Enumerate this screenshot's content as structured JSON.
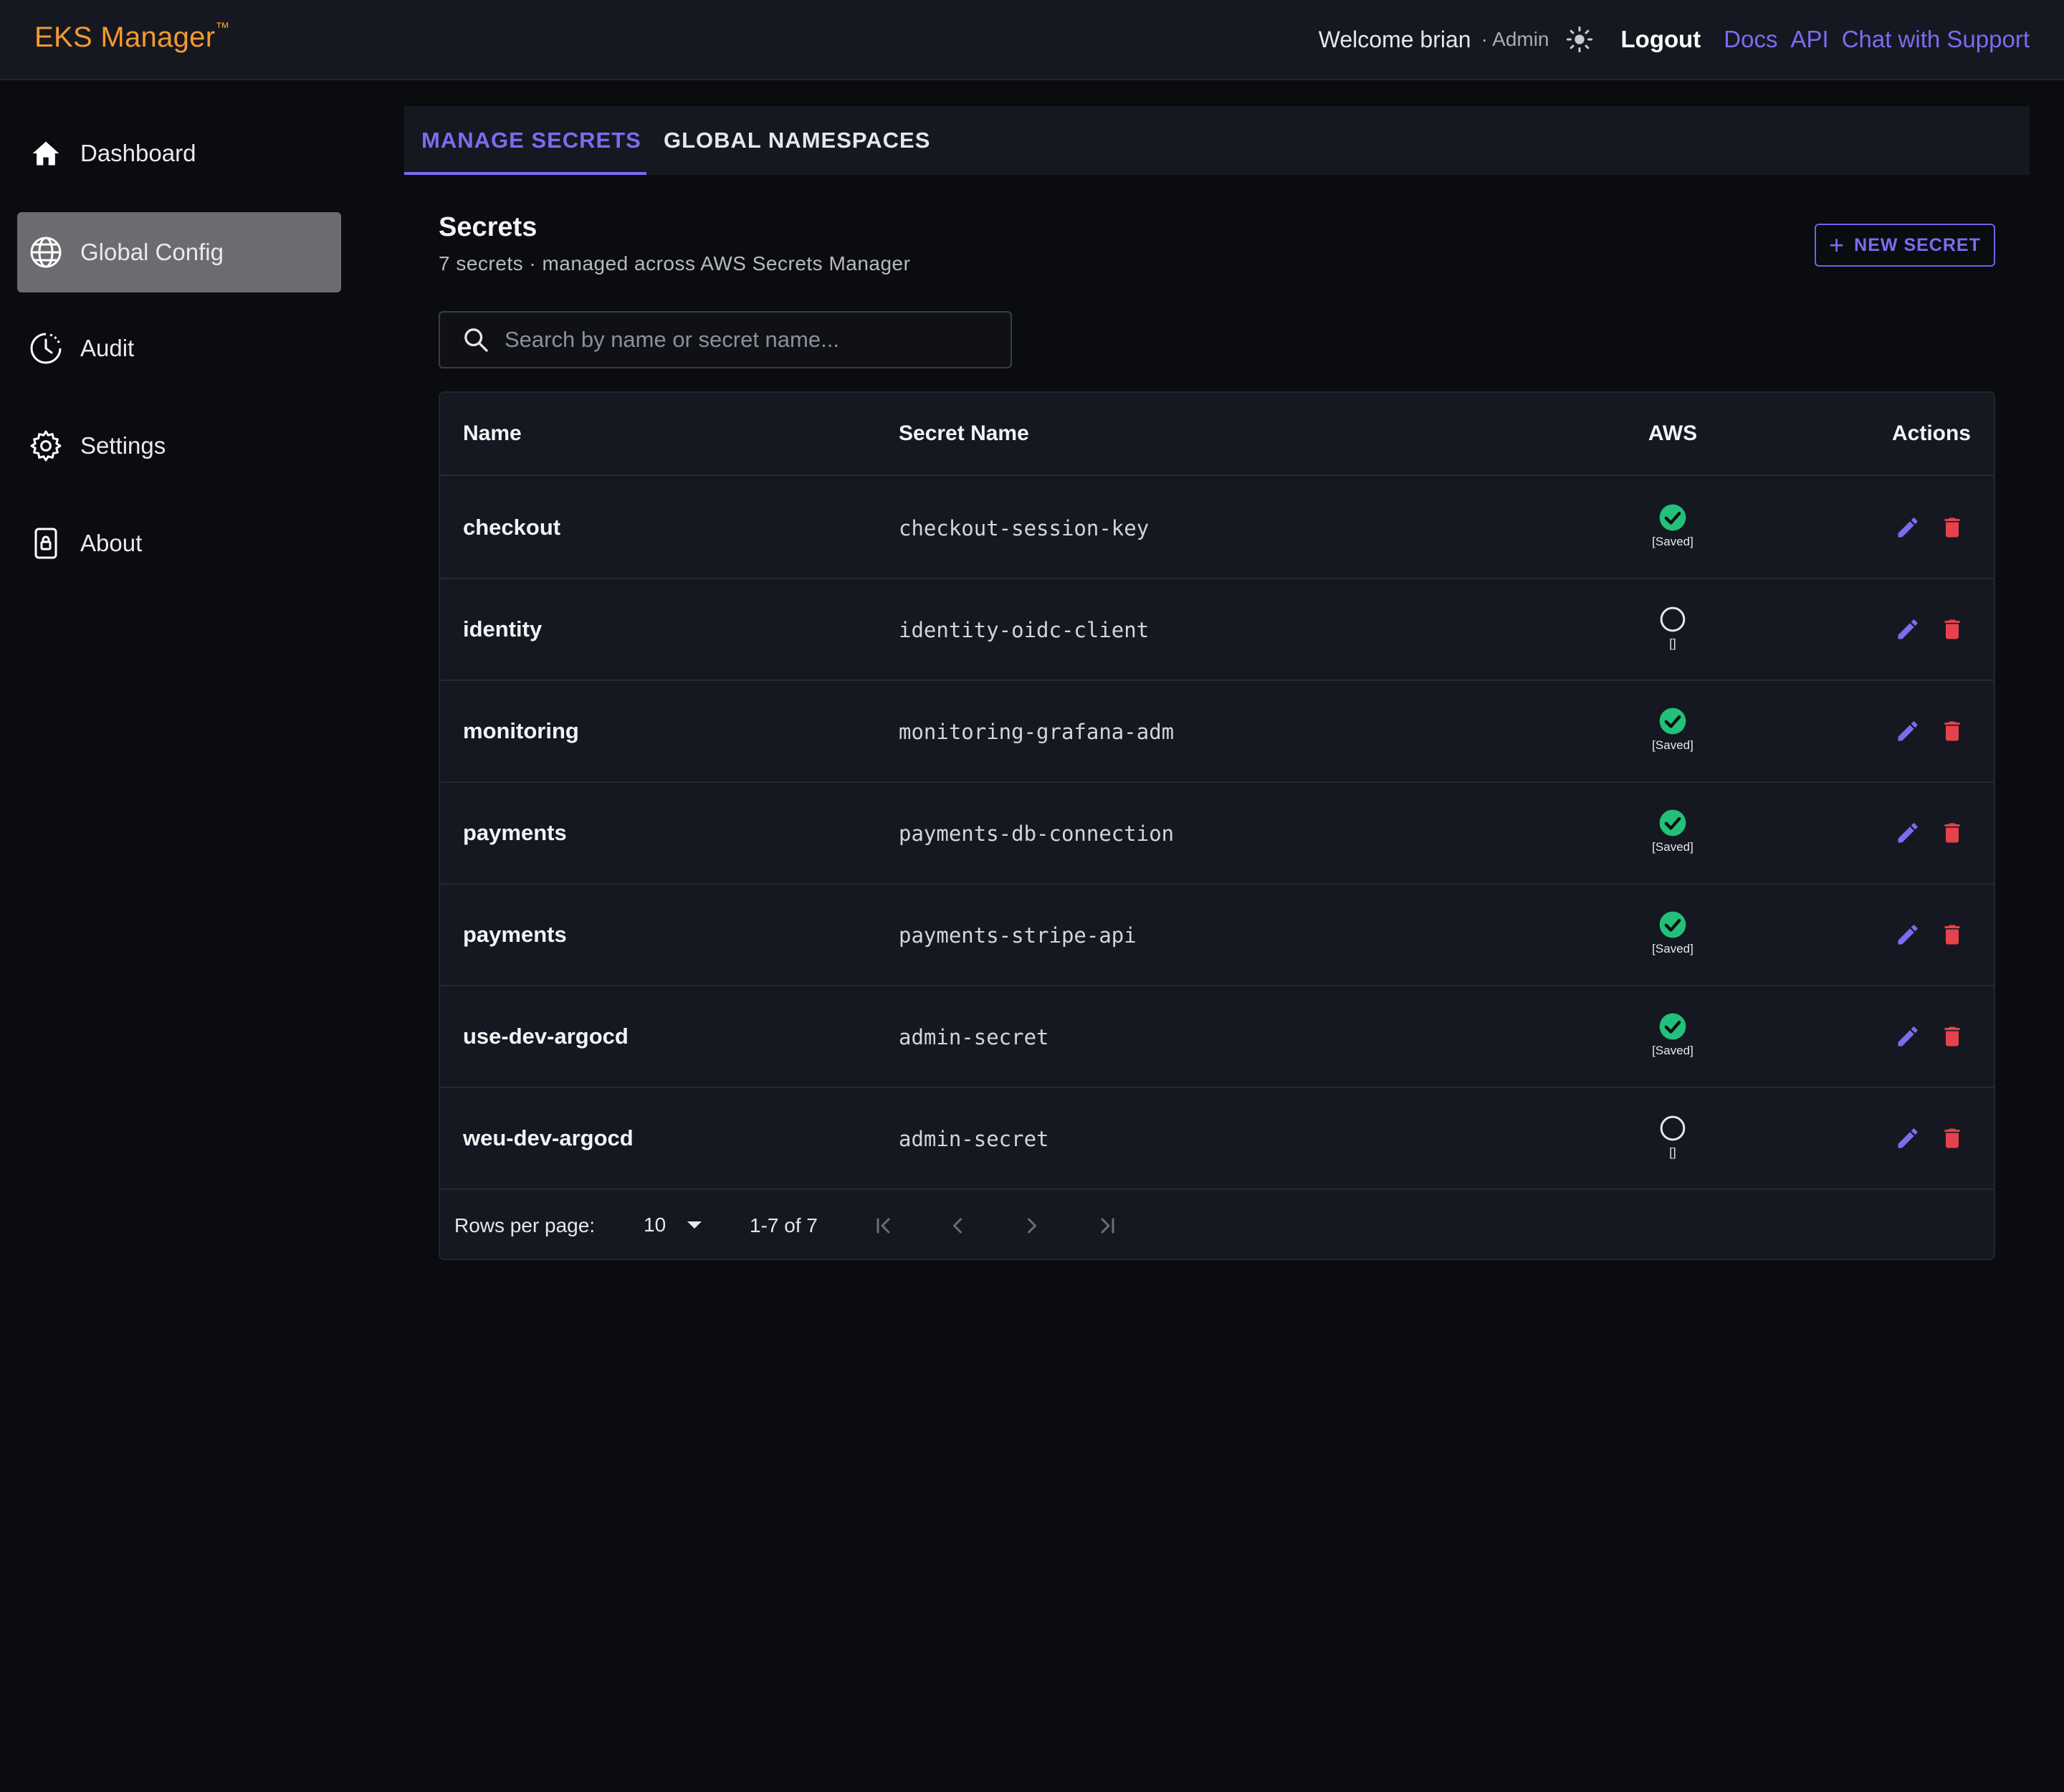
{
  "app": {
    "title": "EKS Manager",
    "trademark": "™"
  },
  "header": {
    "welcome": "Welcome brian",
    "role": "· Admin",
    "theme_icon": "sun-icon",
    "logout": "Logout",
    "links": [
      "Docs",
      "API",
      "Chat with Support"
    ]
  },
  "sidebar": {
    "items": [
      {
        "label": "Dashboard",
        "icon": "home-icon",
        "active": false
      },
      {
        "label": "Global Config",
        "icon": "globe-icon",
        "active": true
      },
      {
        "label": "Audit",
        "icon": "clock-icon",
        "active": false
      },
      {
        "label": "Settings",
        "icon": "gear-icon",
        "active": false
      },
      {
        "label": "About",
        "icon": "lock-icon",
        "active": false
      }
    ]
  },
  "tabs": [
    {
      "label": "MANAGE SECRETS",
      "active": true
    },
    {
      "label": "GLOBAL NAMESPACES",
      "active": false
    }
  ],
  "page": {
    "title": "Secrets",
    "subtitle": "7 secrets · managed across AWS Secrets Manager",
    "new_button": "NEW SECRET"
  },
  "search": {
    "placeholder": "Search by name or secret name...",
    "value": ""
  },
  "table": {
    "columns": [
      "Name",
      "Secret Name",
      "AWS",
      "Actions"
    ],
    "rows": [
      {
        "name": "checkout",
        "secret": "checkout-session-key",
        "aws_saved": true,
        "aws_label": "[Saved]"
      },
      {
        "name": "identity",
        "secret": "identity-oidc-client",
        "aws_saved": false,
        "aws_label": "[]"
      },
      {
        "name": "monitoring",
        "secret": "monitoring-grafana-adm",
        "aws_saved": true,
        "aws_label": "[Saved]"
      },
      {
        "name": "payments",
        "secret": "payments-db-connection",
        "aws_saved": true,
        "aws_label": "[Saved]"
      },
      {
        "name": "payments",
        "secret": "payments-stripe-api",
        "aws_saved": true,
        "aws_label": "[Saved]"
      },
      {
        "name": "use-dev-argocd",
        "secret": "admin-secret",
        "aws_saved": true,
        "aws_label": "[Saved]"
      },
      {
        "name": "weu-dev-argocd",
        "secret": "admin-secret",
        "aws_saved": false,
        "aws_label": "[]"
      }
    ]
  },
  "pagination": {
    "rows_per_page_label": "Rows per page:",
    "rows_per_page": "10",
    "range": "1-7 of 7"
  },
  "colors": {
    "accent": "#7b6cf0",
    "brand": "#f39a2b",
    "success": "#22c07a",
    "danger": "#e5424d",
    "background": "#0b0c10",
    "surface": "#151820"
  }
}
